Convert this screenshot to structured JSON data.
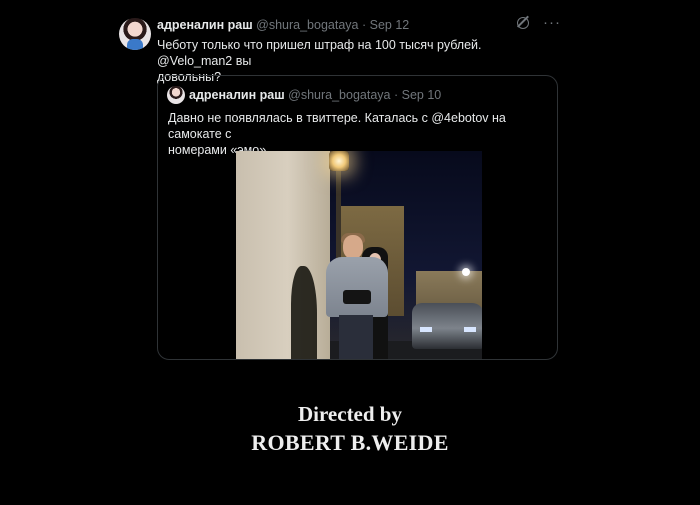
{
  "tweet": {
    "display_name": "адреналин раш",
    "handle": "@shura_bogataya",
    "separator": "·",
    "date": "Sep 12",
    "text_line1": "Чеботу только что пришел штраф на 100 тысяч рублей.  @Velo_man2 вы",
    "text_line2": "довольны?",
    "more_icon": "···"
  },
  "quoted": {
    "display_name": "адреналин раш",
    "handle": "@shura_bogataya",
    "separator": "·",
    "date": "Sep 10",
    "text_line1": "Давно не появлялась в твиттере. Каталась с @4ebotov на самокате с",
    "text_line2": "номерами «эмо»"
  },
  "credits": {
    "line1": "Directed by",
    "line2": "ROBERT B.WEIDE"
  },
  "colors": {
    "background": "#000000",
    "text": "#e7e9ea",
    "muted": "#71767b",
    "border": "#2f3336"
  }
}
